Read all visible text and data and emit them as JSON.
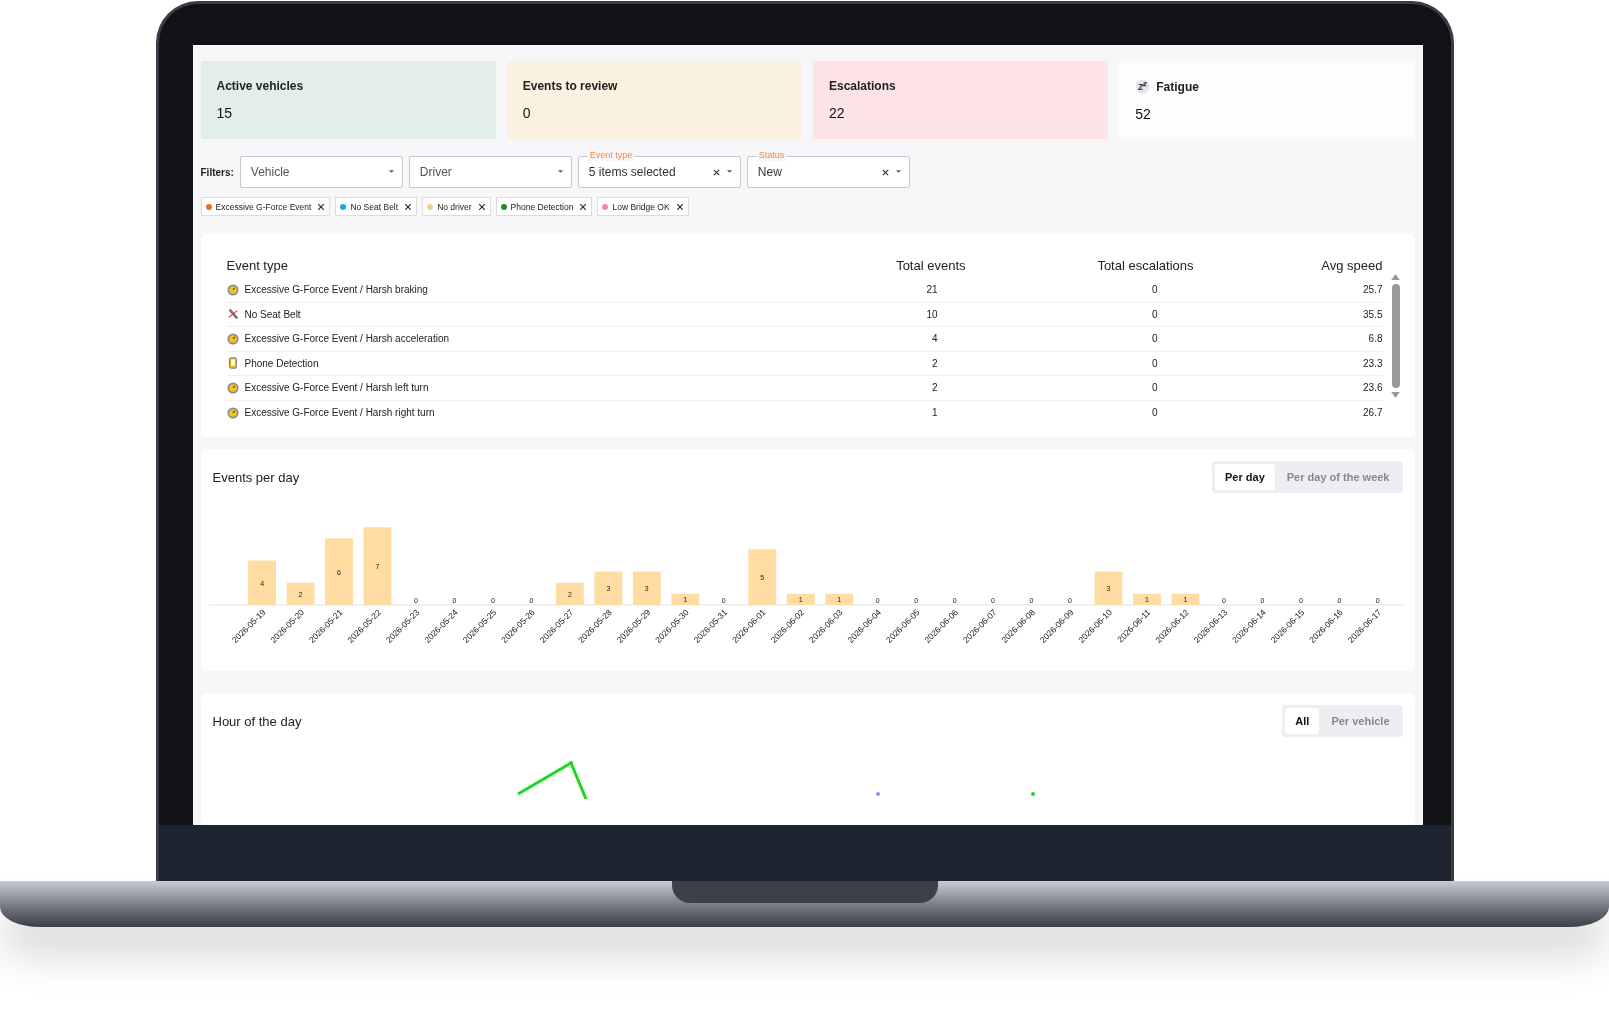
{
  "cards": [
    {
      "title": "Active vehicles",
      "value": "15",
      "color": "#e2eeea",
      "kind": "plain"
    },
    {
      "title": "Events to review",
      "value": "0",
      "color": "#fbf1e1",
      "kind": "plain"
    },
    {
      "title": "Escalations",
      "value": "22",
      "color": "#fce4e6",
      "kind": "plain"
    },
    {
      "title": "Fatigue",
      "value": "52",
      "color": "#fdfcfe",
      "kind": "icon"
    }
  ],
  "filters": {
    "label": "Filters:",
    "fields": [
      {
        "placeholder": "Vehicle"
      },
      {
        "placeholder": "Driver"
      },
      {
        "label": "Event type",
        "value": "5 items selected"
      },
      {
        "label": "Status",
        "value": "New"
      }
    ]
  },
  "chips": [
    {
      "label": "Excessive G-Force Event",
      "color": "#f26b1d"
    },
    {
      "label": "No Seat Belt",
      "color": "#1ea7e1"
    },
    {
      "label": "No driver",
      "color": "#f7cf8a"
    },
    {
      "label": "Phone Detection",
      "color": "#1a8f2e"
    },
    {
      "label": "Low Bridge OK",
      "color": "#f28b9b"
    }
  ],
  "table": {
    "columns": [
      "Event type",
      "Total events",
      "Total escalations",
      "Avg speed"
    ],
    "rows": [
      {
        "kind": "gforce",
        "cells": [
          "Excessive G-Force Event / Harsh braking",
          "21",
          "0",
          "25.7"
        ]
      },
      {
        "kind": "seatbelt",
        "cells": [
          "No Seat Belt",
          "10",
          "0",
          "35.5"
        ]
      },
      {
        "kind": "gforce",
        "cells": [
          "Excessive G-Force Event / Harsh acceleration",
          "4",
          "0",
          "6.8"
        ]
      },
      {
        "kind": "phone",
        "cells": [
          "Phone Detection",
          "2",
          "0",
          "23.3"
        ]
      },
      {
        "kind": "gforce",
        "cells": [
          "Excessive G-Force Event / Harsh left turn",
          "2",
          "0",
          "23.6"
        ]
      },
      {
        "kind": "gforce",
        "cells": [
          "Excessive G-Force Event / Harsh right turn",
          "1",
          "0",
          "26.7"
        ]
      }
    ]
  },
  "events_chart": {
    "title": "Events per day",
    "toggle": [
      {
        "label": "Per day",
        "selected": true
      },
      {
        "label": "Per day of the week",
        "selected": false
      }
    ],
    "chart_data": {
      "type": "bar",
      "data_labels": true,
      "categories": [
        "2026-05-19",
        "2026-05-20",
        "2026-05-21",
        "2026-05-22",
        "2026-05-23",
        "2026-05-24",
        "2026-05-25",
        "2026-05-26",
        "2026-05-27",
        "2026-05-28",
        "2026-05-29",
        "2026-05-30",
        "2026-05-31",
        "2026-06-01",
        "2026-06-02",
        "2026-06-03",
        "2026-06-04",
        "2026-06-05",
        "2026-06-06",
        "2026-06-07",
        "2026-06-08",
        "2026-06-09",
        "2026-06-10",
        "2026-06-11",
        "2026-06-12",
        "2026-06-13",
        "2026-06-14",
        "2026-06-15",
        "2026-06-16",
        "2026-06-17"
      ],
      "values": [
        4,
        2,
        6,
        7,
        0,
        0,
        0,
        0,
        2,
        3,
        3,
        1,
        0,
        5,
        1,
        1,
        0,
        0,
        0,
        0,
        0,
        0,
        3,
        1,
        1,
        0,
        0,
        0,
        0,
        0
      ]
    }
  },
  "hour_chart": {
    "title": "Hour of the day",
    "toggle": [
      {
        "label": "All",
        "selected": true
      },
      {
        "label": "Per vehicle",
        "selected": false
      }
    ]
  }
}
